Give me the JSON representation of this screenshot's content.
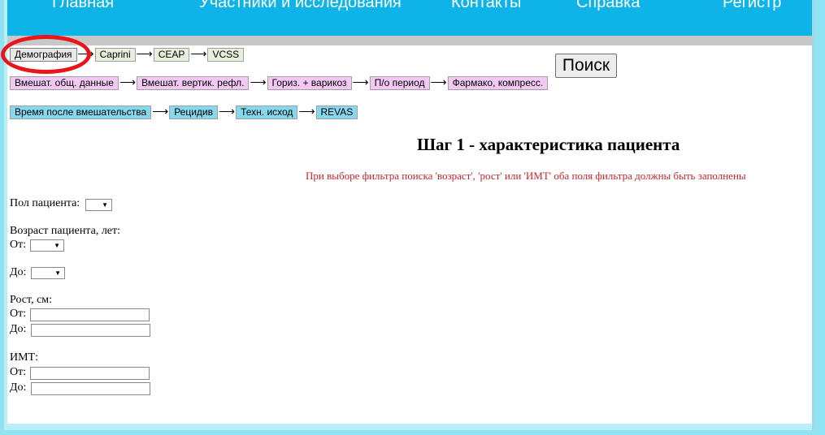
{
  "nav": {
    "items": [
      "Главная",
      "Участники и исследования",
      "Контакты",
      "Справка",
      "Регистр"
    ]
  },
  "breadcrumbs": {
    "row1": [
      "Демография",
      "Caprini",
      "CEAP",
      "VCSS"
    ],
    "row2": [
      "Вмешат. общ. данные",
      "Вмешат. вертик. рефл.",
      "Гориз. + варикоз",
      "П/о период",
      "Фармако, компресс."
    ],
    "row3": [
      "Время после вмешательства",
      "Рецидив",
      "Техн. исход",
      "REVAS"
    ],
    "arrow": "⟶"
  },
  "search_label": "Поиск",
  "step_title": "Шаг 1 - характеристика пациента",
  "warning": "При выборе фильтра поиска 'возраст', 'рост' или 'ИМТ' оба поля фильтра должны быть заполнены",
  "form": {
    "sex_label": "Пол пациента:",
    "age_label": "Возраст пациента, лет:",
    "height_label": "Рост, см:",
    "bmi_label": "ИМТ:",
    "from_label": "От:",
    "to_label": "До:",
    "dropdown_glyph": "▼"
  },
  "colors": {
    "nav_bg": "#0eb4e8",
    "tag_green": "#e6f0dc",
    "tag_pink": "#f4c8f4",
    "tag_blue": "#86d8ee",
    "warning": "#c0262c",
    "annotation_circle": "#e8151b"
  }
}
